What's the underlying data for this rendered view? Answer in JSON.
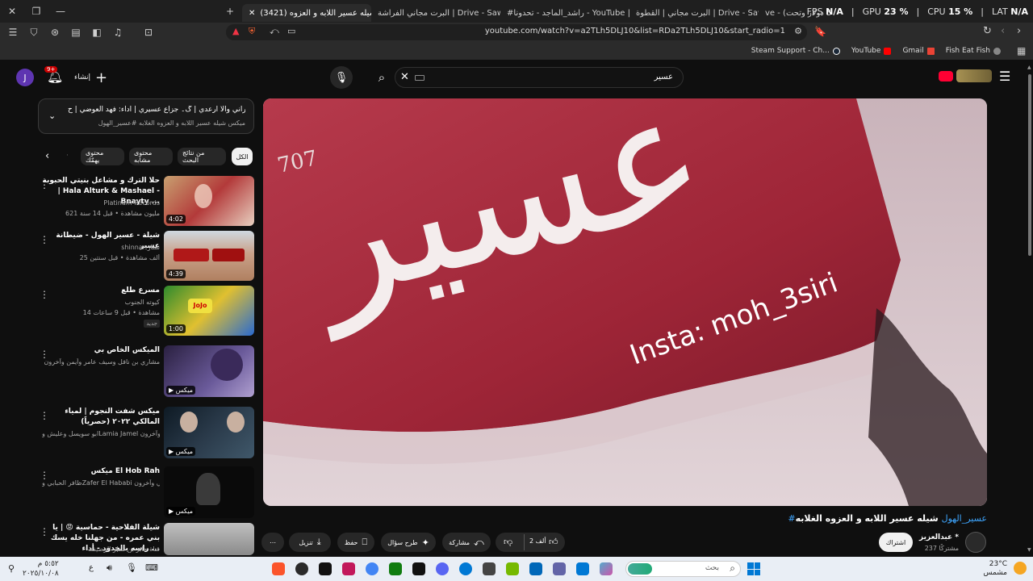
{
  "tabs": [
    {
      "label": "(3421) شيله عسير اللابه و العزوه ...",
      "active": true,
      "fav": "youtube"
    },
    {
      "label": "البرت مجاني الفراشة | Drive - SawGx3",
      "active": false,
      "fav": "drive"
    },
    {
      "label": "#راشد_الماجد - تحدونا - YouTube | jid",
      "active": false,
      "fav": "youtube"
    },
    {
      "label": "البرت مجاني | القطوة | Drive - SawGx3",
      "active": false,
      "fav": "drive"
    },
    {
      "label": "ve - (حق 5 دولار وتحت)",
      "active": false,
      "fav": "none"
    }
  ],
  "stats": {
    "fps_label": "FPS",
    "fps_value": "N/A",
    "gpu_label": "GPU",
    "gpu_value": "23 %",
    "cpu_label": "CPU",
    "cpu_value": "15 %",
    "lat_label": "LAT",
    "lat_value": "N/A"
  },
  "address": {
    "url": "youtube.com/watch?v=a2TLh5DLJ10&list=RDa2TLh5DLJ10&start_radio=1"
  },
  "bookmarks": [
    {
      "label": "Steam Support - Ch...",
      "color": "#1b2838"
    },
    {
      "label": "YouTube",
      "color": "#ff0000"
    },
    {
      "label": "Gmail",
      "color": "#ea4335"
    },
    {
      "label": "Fish Eat Fish",
      "color": "#888888"
    }
  ],
  "header": {
    "create_label": "إنشاء",
    "notif_count": "9+",
    "avatar_letter": "J",
    "search_query": "عسير"
  },
  "upnext": {
    "title": "التالي: ابراني والا ارعدي | گ۔ جزاع عسيري | أداء: فهد العوضي | ح...",
    "subtitle": "ميكس شيله عسير اللابه و العزوه الغلابه #عسير_الهول"
  },
  "chips": [
    "الكل",
    "من نتائج البحث",
    "محتوى مشابه",
    "محتوى يهمّك"
  ],
  "playlist": [
    {
      "title": "حلا الترك و مشاعل بنيتي الحبوبة | Hala Alturk & Mashael - Bnayty ...",
      "channel": "Platinum Records",
      "meta": "621 مليون مشاهدة • قبل 14 سنة",
      "duration": "4:02",
      "thumb": "#8a2a2a"
    },
    {
      "title": "شيلة - عسير الهول - ضيطانة عسير",
      "channel": "shinnar شنار",
      "meta": "25 ألف مشاهدة • قبل سنتين",
      "duration": "4:39",
      "thumb": "#c9a28a"
    },
    {
      "title": "مسرع طلع",
      "channel": "كيوته الجنوب",
      "meta": "14 مشاهدة • قبل 9 ساعات",
      "duration": "1:00",
      "thumb": "#3a8a3a",
      "badge": "جديد"
    },
    {
      "title": "الميكس الخاص بي",
      "channel": "مشاري بن نافل وسيف عامر وأيمن وآخرون",
      "meta": "",
      "duration": "ميكس",
      "thumb": "#5a4a7a"
    },
    {
      "title": "ميكس شفت النجوم | لمياء المالكي ٢٠٢٢ (حصرياً)",
      "channel": "ابو سويسل وعليش وLamia Jamel وآخرون",
      "meta": "",
      "duration": "ميكس",
      "thumb": "#2a3a4a"
    },
    {
      "title": "ميكس El Hob Rah",
      "channel": "ظافر الحبابي وZafer El Hababi وسعود الصليلي وآخرون",
      "meta": "",
      "duration": "ميكس",
      "thumb": "#151515"
    },
    {
      "title": "شيلة الفلاحية - حماسية 😡 | يا بني عمره - من جهلنا خله يسك راسه بالجدود - أداء ...",
      "channel": "قناة جابر بن مطر الرصيفة",
      "meta": "",
      "duration": "",
      "thumb": "#9a9a9a"
    }
  ],
  "player": {
    "overlay_big": "عسير",
    "overlay_num": "707",
    "overlay_insta": "Insta: moh_3siri"
  },
  "video": {
    "title": "شيله عسير اللابه و العزوه الغلابه",
    "tag": "#عسير_الهول",
    "channel": "عبدالعزيز",
    "subs": "237 مشتركًا",
    "subscribe": "اشتراك",
    "likes": "2 ألف",
    "share": "مشاركة",
    "ask": "طرح سؤال",
    "save": "حفظ",
    "download": "تنزيل"
  },
  "taskbar": {
    "time": "٥:٥٢ م",
    "date": "٢٠٢٥/١٠/٠٨",
    "temp": "23°C",
    "weather": "مشمس",
    "search": "بحث",
    "lang": "ع"
  }
}
